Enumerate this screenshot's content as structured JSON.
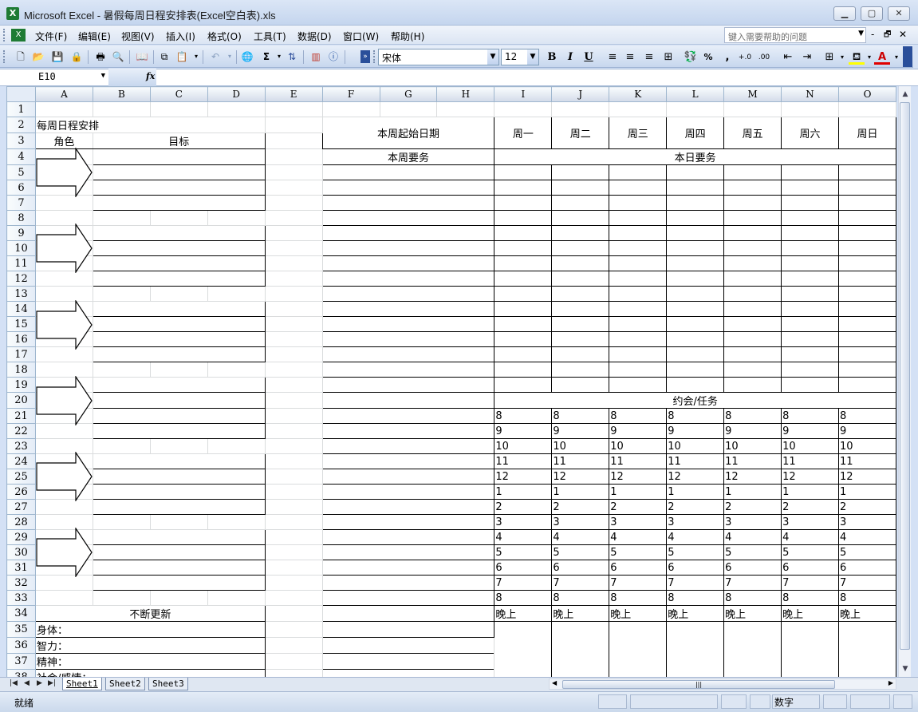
{
  "window": {
    "title": "Microsoft Excel - 暑假每周日程安排表(Excel空白表).xls",
    "min": "▁",
    "max": "▢",
    "close": "✕"
  },
  "menu": [
    "文件(F)",
    "编辑(E)",
    "视图(V)",
    "插入(I)",
    "格式(O)",
    "工具(T)",
    "数据(D)",
    "窗口(W)",
    "帮助(H)"
  ],
  "help_placeholder": "键入需要帮助的问题",
  "doc_controls": [
    "-",
    "🗗",
    "✕"
  ],
  "toolbar": {
    "font": "宋体",
    "size": "12",
    "bold": "B",
    "italic": "I",
    "underline": "U",
    "percent": "%",
    "comma": ","
  },
  "formula": {
    "cell": "E10",
    "fx": "fx"
  },
  "columns": [
    "A",
    "B",
    "C",
    "D",
    "E",
    "F",
    "G",
    "H",
    "I",
    "J",
    "K",
    "L",
    "M",
    "N",
    "O"
  ],
  "rows": [
    "1",
    "2",
    "3",
    "4",
    "5",
    "6",
    "7",
    "8",
    "9",
    "10",
    "11",
    "12",
    "13",
    "14",
    "15",
    "16",
    "17",
    "18",
    "19",
    "20",
    "21",
    "22",
    "23",
    "24",
    "25",
    "26",
    "27",
    "28",
    "29",
    "30",
    "31",
    "32",
    "33",
    "34",
    "35",
    "36",
    "37",
    "38"
  ],
  "sheet": {
    "weekly_title": "每周日程安排",
    "role_header": "角色",
    "goal_header": "目标",
    "start_date_label": "本周起始日期",
    "weekdays": [
      "周一",
      "周二",
      "周三",
      "周四",
      "周五",
      "周六",
      "周日"
    ],
    "week_tasks": "本周要务",
    "day_tasks": "本日要务",
    "appointments": "约会/任务",
    "hours": [
      "8",
      "9",
      "10",
      "11",
      "12",
      "1",
      "2",
      "3",
      "4",
      "5",
      "6",
      "7",
      "8",
      "晚上"
    ],
    "renew_title": "不断更新",
    "renew_items": [
      "身体：",
      "智力：",
      "精神：",
      "社会/感情："
    ]
  },
  "tabs": [
    "Sheet1",
    "Sheet2",
    "Sheet3"
  ],
  "status": {
    "left": "就绪",
    "mode": "数字"
  }
}
